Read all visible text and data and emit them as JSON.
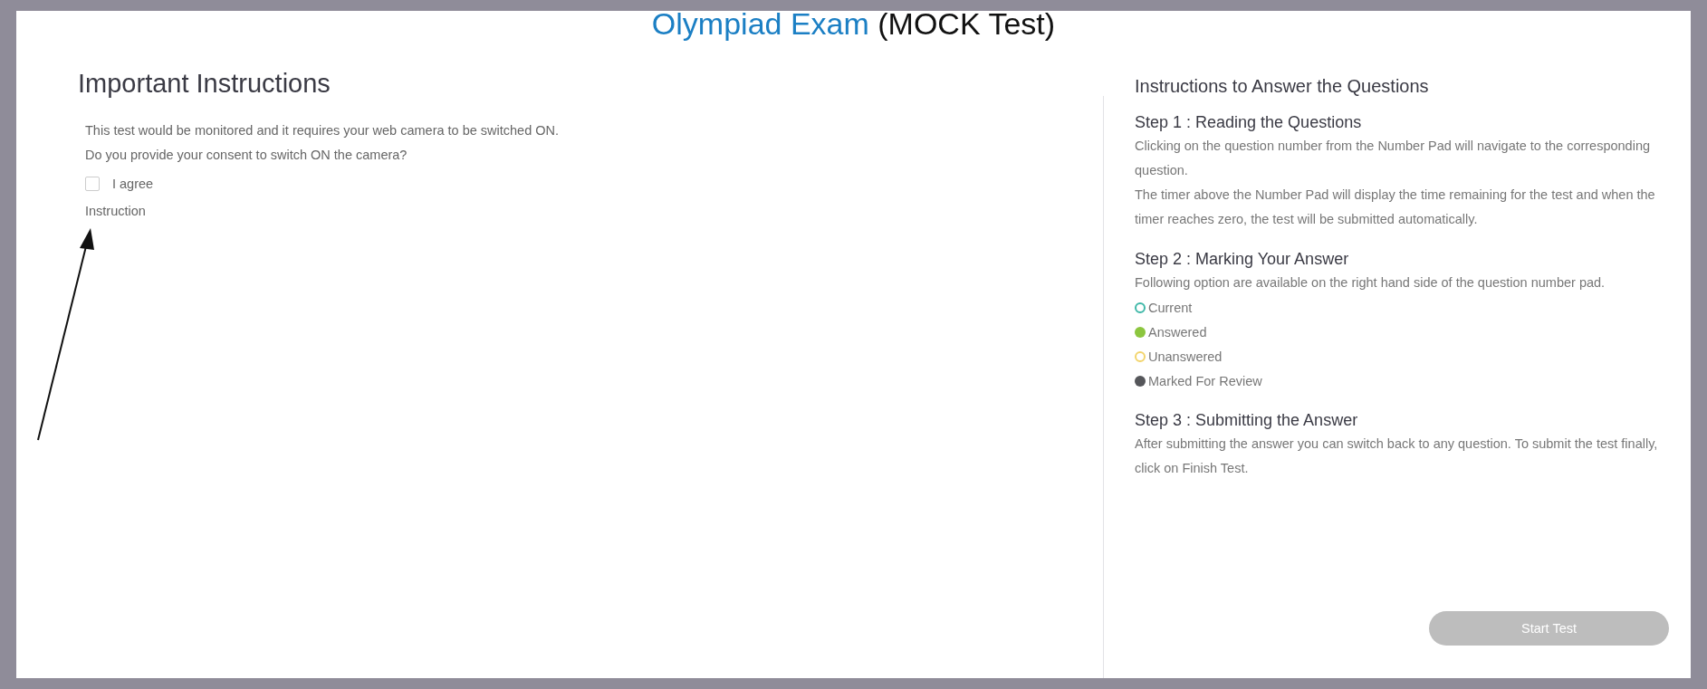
{
  "title": {
    "main": "Olympiad Exam",
    "sub": "(MOCK Test)"
  },
  "left": {
    "heading": "Important Instructions",
    "lines": [
      "This test would be monitored and it requires your web camera to be switched ON.",
      "Do you provide your consent to switch ON the camera?"
    ],
    "consent": {
      "label": "I agree",
      "checked": false
    },
    "instruction_label": "Instruction"
  },
  "right": {
    "heading": "Instructions to Answer the Questions",
    "steps": [
      {
        "title": "Step 1 : Reading the Questions",
        "paragraphs": [
          "Clicking on the question number from the Number Pad will navigate to the corresponding question.",
          "The timer above the Number Pad will display the time remaining for the test and when the timer reaches zero, the test will be submitted automatically."
        ]
      },
      {
        "title": "Step 2 : Marking Your Answer",
        "paragraphs": [
          "Following option are available on the right hand side of the question number pad."
        ],
        "legend": [
          {
            "label": "Current",
            "kind": "ring",
            "color": "#3fb8a8"
          },
          {
            "label": "Answered",
            "kind": "dot",
            "color": "#8cc63f"
          },
          {
            "label": "Unanswered",
            "kind": "ring",
            "color": "#f2d46b"
          },
          {
            "label": "Marked For Review",
            "kind": "dot",
            "color": "#55565a"
          }
        ]
      },
      {
        "title": "Step 3 : Submitting the Answer",
        "paragraphs": [
          "After submitting the answer you can switch back to any question. To submit the test finally, click on Finish Test."
        ]
      }
    ],
    "start_button": {
      "label": "Start Test",
      "disabled": true
    }
  }
}
